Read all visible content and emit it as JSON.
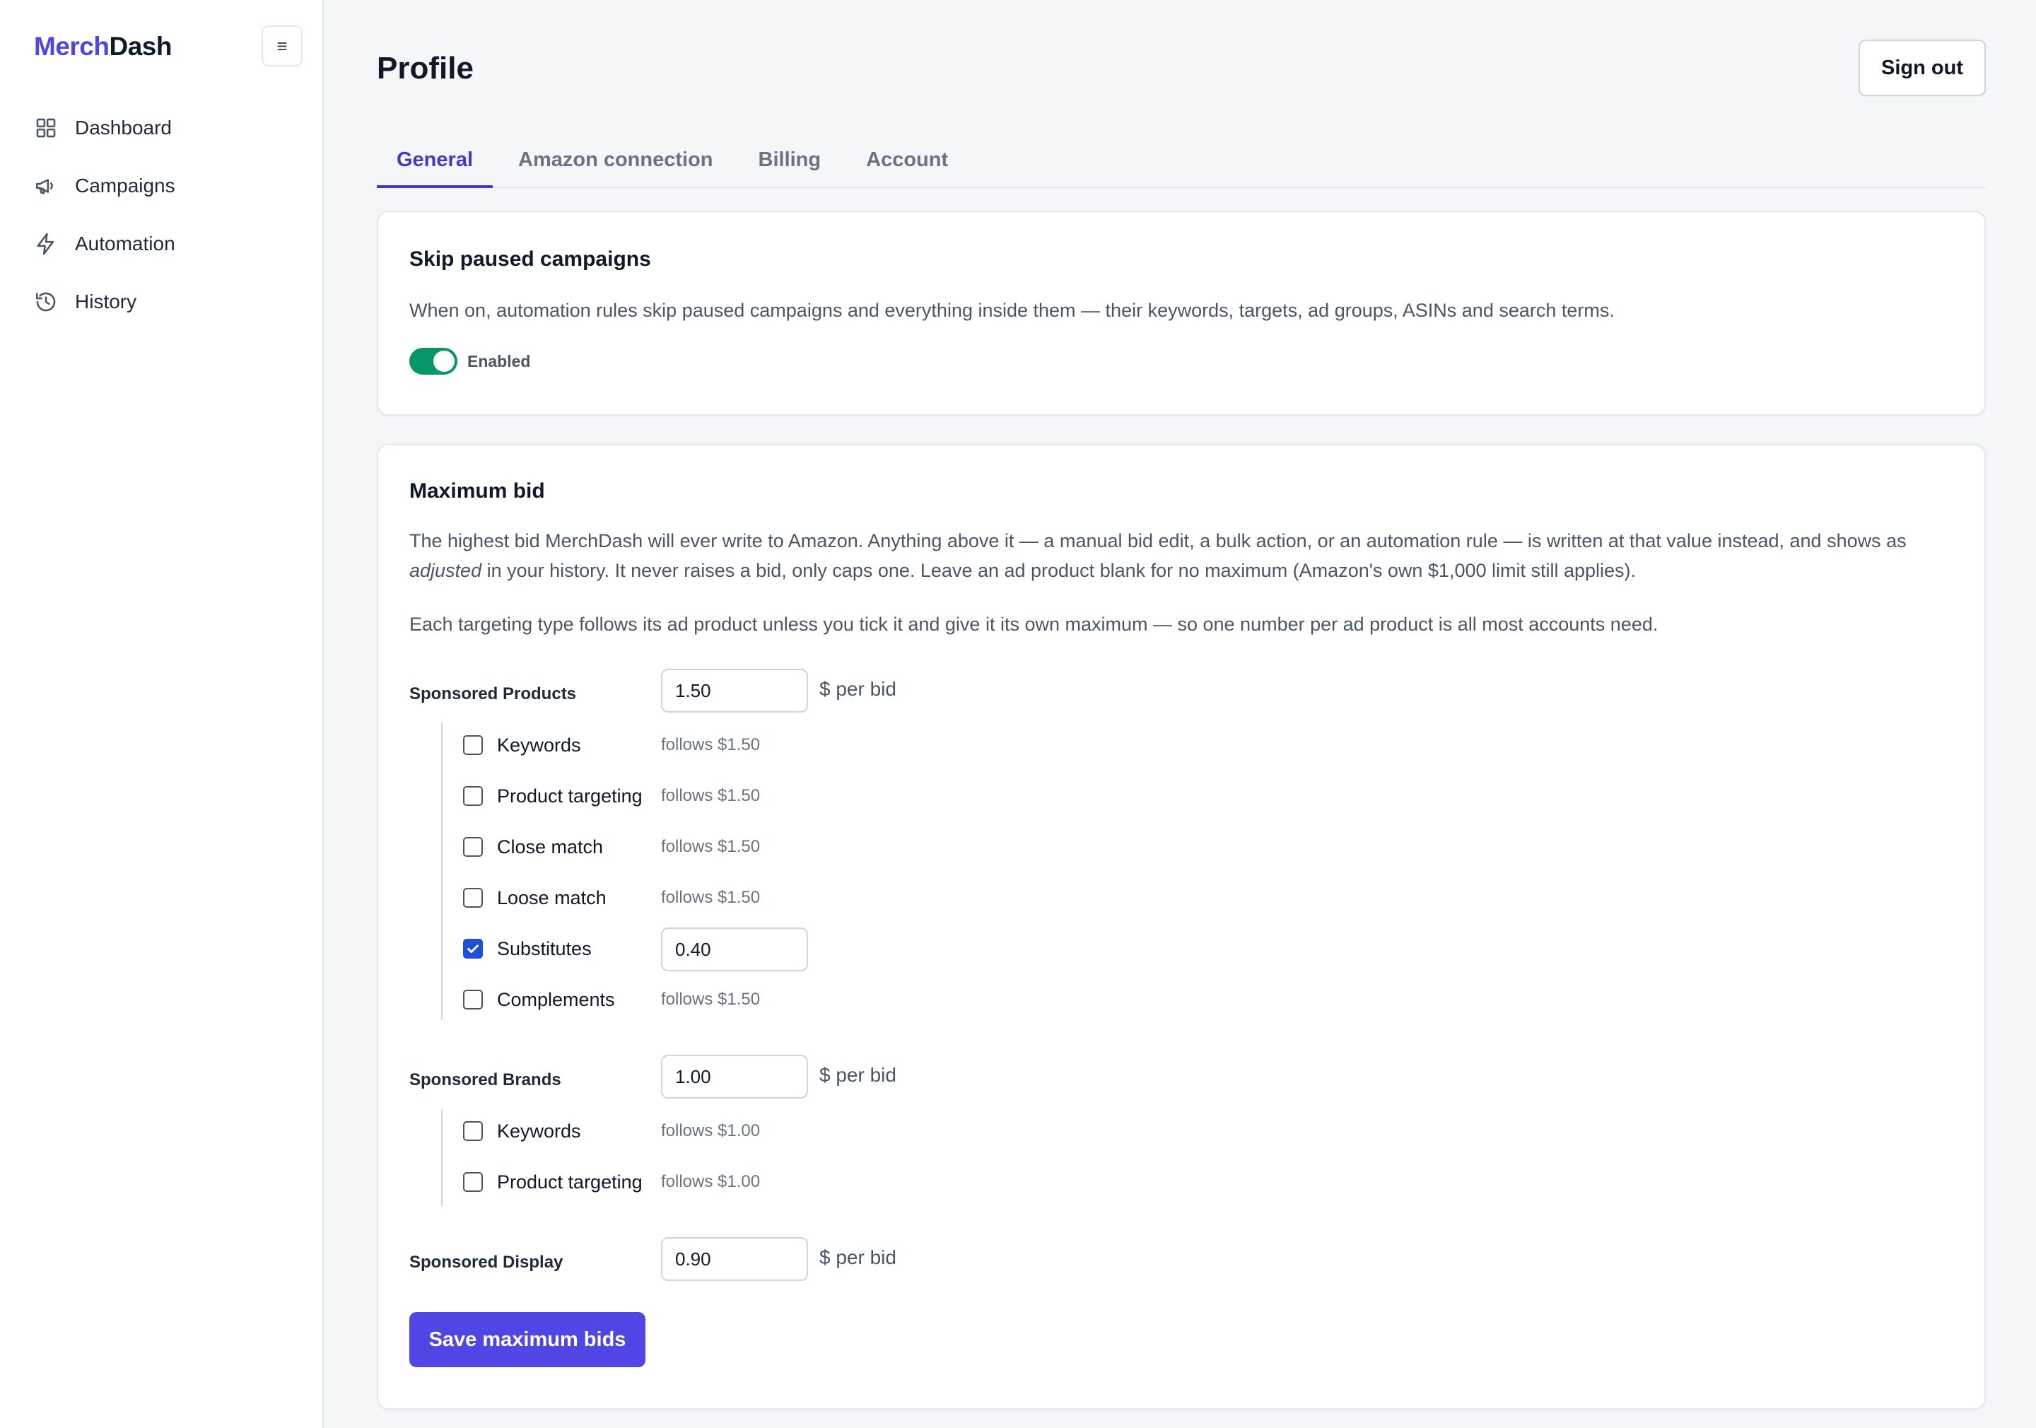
{
  "brand": {
    "part1": "Merch",
    "part2": "Dash"
  },
  "sidebar": {
    "toggle_glyph": "≡",
    "items": [
      {
        "label": "Dashboard",
        "icon": "grid-icon"
      },
      {
        "label": "Campaigns",
        "icon": "megaphone-icon"
      },
      {
        "label": "Automation",
        "icon": "lightning-icon"
      },
      {
        "label": "History",
        "icon": "history-icon"
      }
    ]
  },
  "header": {
    "title": "Profile",
    "signout_label": "Sign out"
  },
  "tabs": [
    {
      "label": "General",
      "active": true
    },
    {
      "label": "Amazon connection",
      "active": false
    },
    {
      "label": "Billing",
      "active": false
    },
    {
      "label": "Account",
      "active": false
    }
  ],
  "skip_paused": {
    "title": "Skip paused campaigns",
    "description": "When on, automation rules skip paused campaigns and everything inside them — their keywords, targets, ad groups, ASINs and search terms.",
    "toggle_on": true,
    "toggle_label": "Enabled"
  },
  "max_bid": {
    "title": "Maximum bid",
    "desc1_a": "The highest bid MerchDash will ever write to Amazon. Anything above it — a manual bid edit, a bulk action, or an automation rule — is written at that value instead, and shows as ",
    "desc1_em": "adjusted",
    "desc1_b": " in your history. It never raises a bid, only caps one. Leave an ad product blank for no maximum (Amazon's own $1,000 limit still applies).",
    "desc2": "Each targeting type follows its ad product unless you tick it and give it its own maximum — so one number per ad product is all most accounts need.",
    "unit": "$ per bid",
    "products": [
      {
        "label": "Sponsored Products",
        "value": "1.50",
        "subs": [
          {
            "label": "Keywords",
            "checked": false,
            "follows": "follows $1.50"
          },
          {
            "label": "Product targeting",
            "checked": false,
            "follows": "follows $1.50"
          },
          {
            "label": "Close match",
            "checked": false,
            "follows": "follows $1.50"
          },
          {
            "label": "Loose match",
            "checked": false,
            "follows": "follows $1.50"
          },
          {
            "label": "Substitutes",
            "checked": true,
            "value": "0.40"
          },
          {
            "label": "Complements",
            "checked": false,
            "follows": "follows $1.50"
          }
        ]
      },
      {
        "label": "Sponsored Brands",
        "value": "1.00",
        "subs": [
          {
            "label": "Keywords",
            "checked": false,
            "follows": "follows $1.00"
          },
          {
            "label": "Product targeting",
            "checked": false,
            "follows": "follows $1.00"
          }
        ]
      },
      {
        "label": "Sponsored Display",
        "value": "0.90",
        "subs": []
      }
    ],
    "save_label": "Save maximum bids"
  },
  "colors": {
    "brand_accent": "#4f46e5",
    "toggle_on": "#059669",
    "checkbox_checked": "#1d4ed8",
    "tab_active": "#4338ca"
  }
}
